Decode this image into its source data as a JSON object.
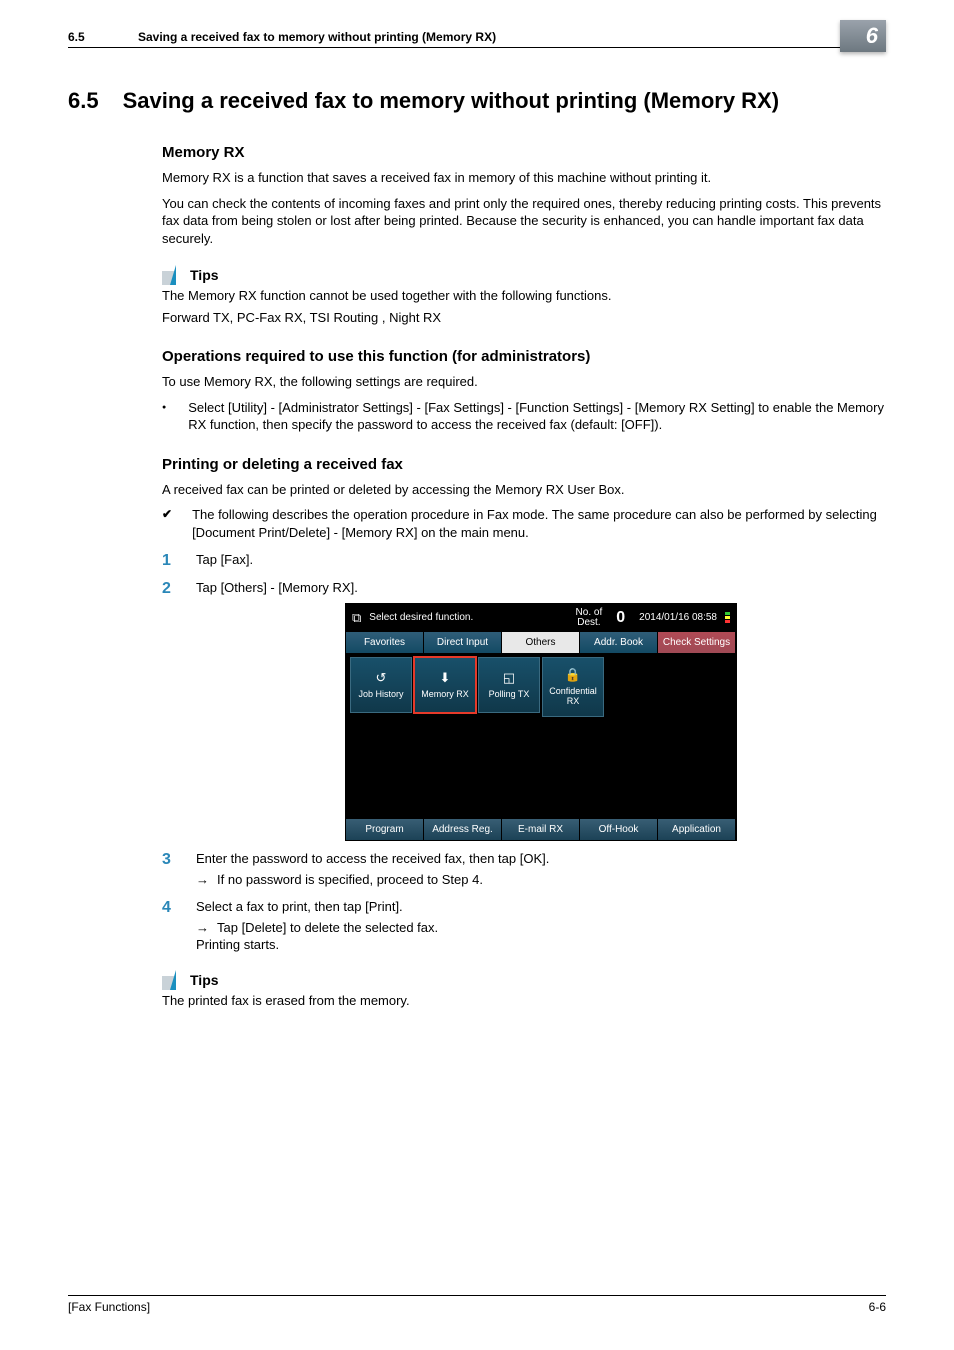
{
  "runningHeader": {
    "num": "6.5",
    "title": "Saving a received fax to memory without printing (Memory RX)"
  },
  "chapterTab": "6",
  "h1": {
    "num": "6.5",
    "title": "Saving a received fax to memory without printing (Memory RX)"
  },
  "memoryRx": {
    "heading": "Memory RX",
    "p1": "Memory RX is a function that saves a received fax in memory of this machine without printing it.",
    "p2": "You can check the contents of incoming faxes and print only the required ones, thereby reducing printing costs. This prevents fax data from being stolen or lost after being printed. Because the security is enhanced, you can handle important fax data securely."
  },
  "tips1": {
    "label": "Tips",
    "line1": "The Memory RX function cannot be used together with the following functions.",
    "line2": "Forward TX, PC-Fax RX, TSI Routing , Night RX"
  },
  "ops": {
    "heading": "Operations required to use this function (for administrators)",
    "p1": "To use Memory RX, the following settings are required.",
    "bullet1": "Select [Utility] - [Administrator Settings] - [Fax Settings] - [Function Settings] - [Memory RX Setting] to enable the Memory RX function, then specify the password to access the received fax (default: [OFF])."
  },
  "printing": {
    "heading": "Printing or deleting a received fax",
    "p1": "A received fax can be printed or deleted by accessing the Memory RX User Box.",
    "check1": "The following describes the operation procedure in Fax mode. The same procedure can also be performed by selecting [Document Print/Delete] - [Memory RX] on the main menu.",
    "step1": "Tap [Fax].",
    "step2": "Tap [Others] - [Memory RX].",
    "step3": "Enter the password to access the received fax, then tap [OK].",
    "step3sub": "If no password is specified, proceed to Step 4.",
    "step4": "Select a fax to print, then tap [Print].",
    "step4sub": "Tap [Delete] to delete the selected fax.",
    "step4p": "Printing starts."
  },
  "tips2": {
    "label": "Tips",
    "line1": "The printed fax is erased from the memory."
  },
  "device": {
    "prompt": "Select desired function.",
    "destLabel": "No. of\nDest.",
    "destCount": "0",
    "timestamp": "2014/01/16 08:58",
    "tabs": {
      "favorites": "Favorites",
      "direct": "Direct Input",
      "others": "Others",
      "addr": "Addr. Book",
      "check": "Check Settings"
    },
    "buttons": {
      "job": "Job History",
      "memory": "Memory RX",
      "polling": "Polling TX",
      "conf": "Confidential RX"
    },
    "footer": {
      "program": "Program",
      "address": "Address Reg.",
      "email": "E-mail RX",
      "offhook": "Off-Hook",
      "app": "Application"
    }
  },
  "footer": {
    "left": "[Fax Functions]",
    "right": "6-6"
  }
}
